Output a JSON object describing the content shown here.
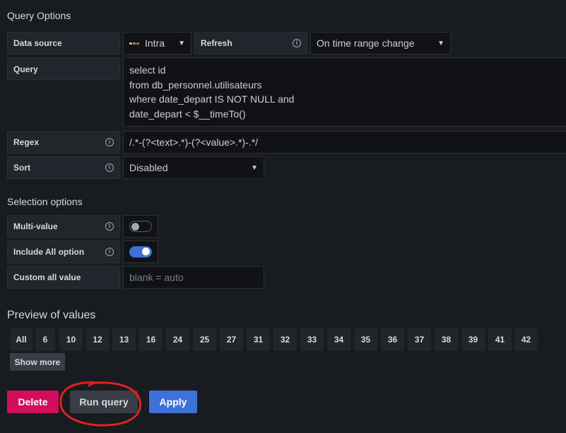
{
  "query_options": {
    "title": "Query Options",
    "data_source_label": "Data source",
    "data_source_value": "Intra",
    "refresh_label": "Refresh",
    "refresh_value": "On time range change",
    "query_label": "Query",
    "query_lines": [
      "select id",
      "from db_personnel.utilisateurs",
      "where date_depart IS NOT NULL and",
      "date_depart < $__timeTo()"
    ],
    "regex_label": "Regex",
    "regex_value": "/.*-(?<text>.*)-(?<value>.*)-.*/",
    "sort_label": "Sort",
    "sort_value": "Disabled"
  },
  "selection_options": {
    "title": "Selection options",
    "multi_value_label": "Multi-value",
    "multi_value_enabled": false,
    "include_all_label": "Include All option",
    "include_all_enabled": true,
    "custom_all_label": "Custom all value",
    "custom_all_placeholder": "blank = auto"
  },
  "preview": {
    "title": "Preview of values",
    "values": [
      "All",
      "6",
      "10",
      "12",
      "13",
      "16",
      "24",
      "25",
      "27",
      "31",
      "32",
      "33",
      "34",
      "35",
      "36",
      "37",
      "38",
      "39",
      "41",
      "42"
    ],
    "show_more_label": "Show more"
  },
  "actions": {
    "delete_label": "Delete",
    "run_query_label": "Run query",
    "apply_label": "Apply"
  },
  "colors": {
    "background": "#181b1f",
    "primary": "#3d71d9",
    "destructive": "#d10e5c",
    "annotation": "#e02020"
  }
}
